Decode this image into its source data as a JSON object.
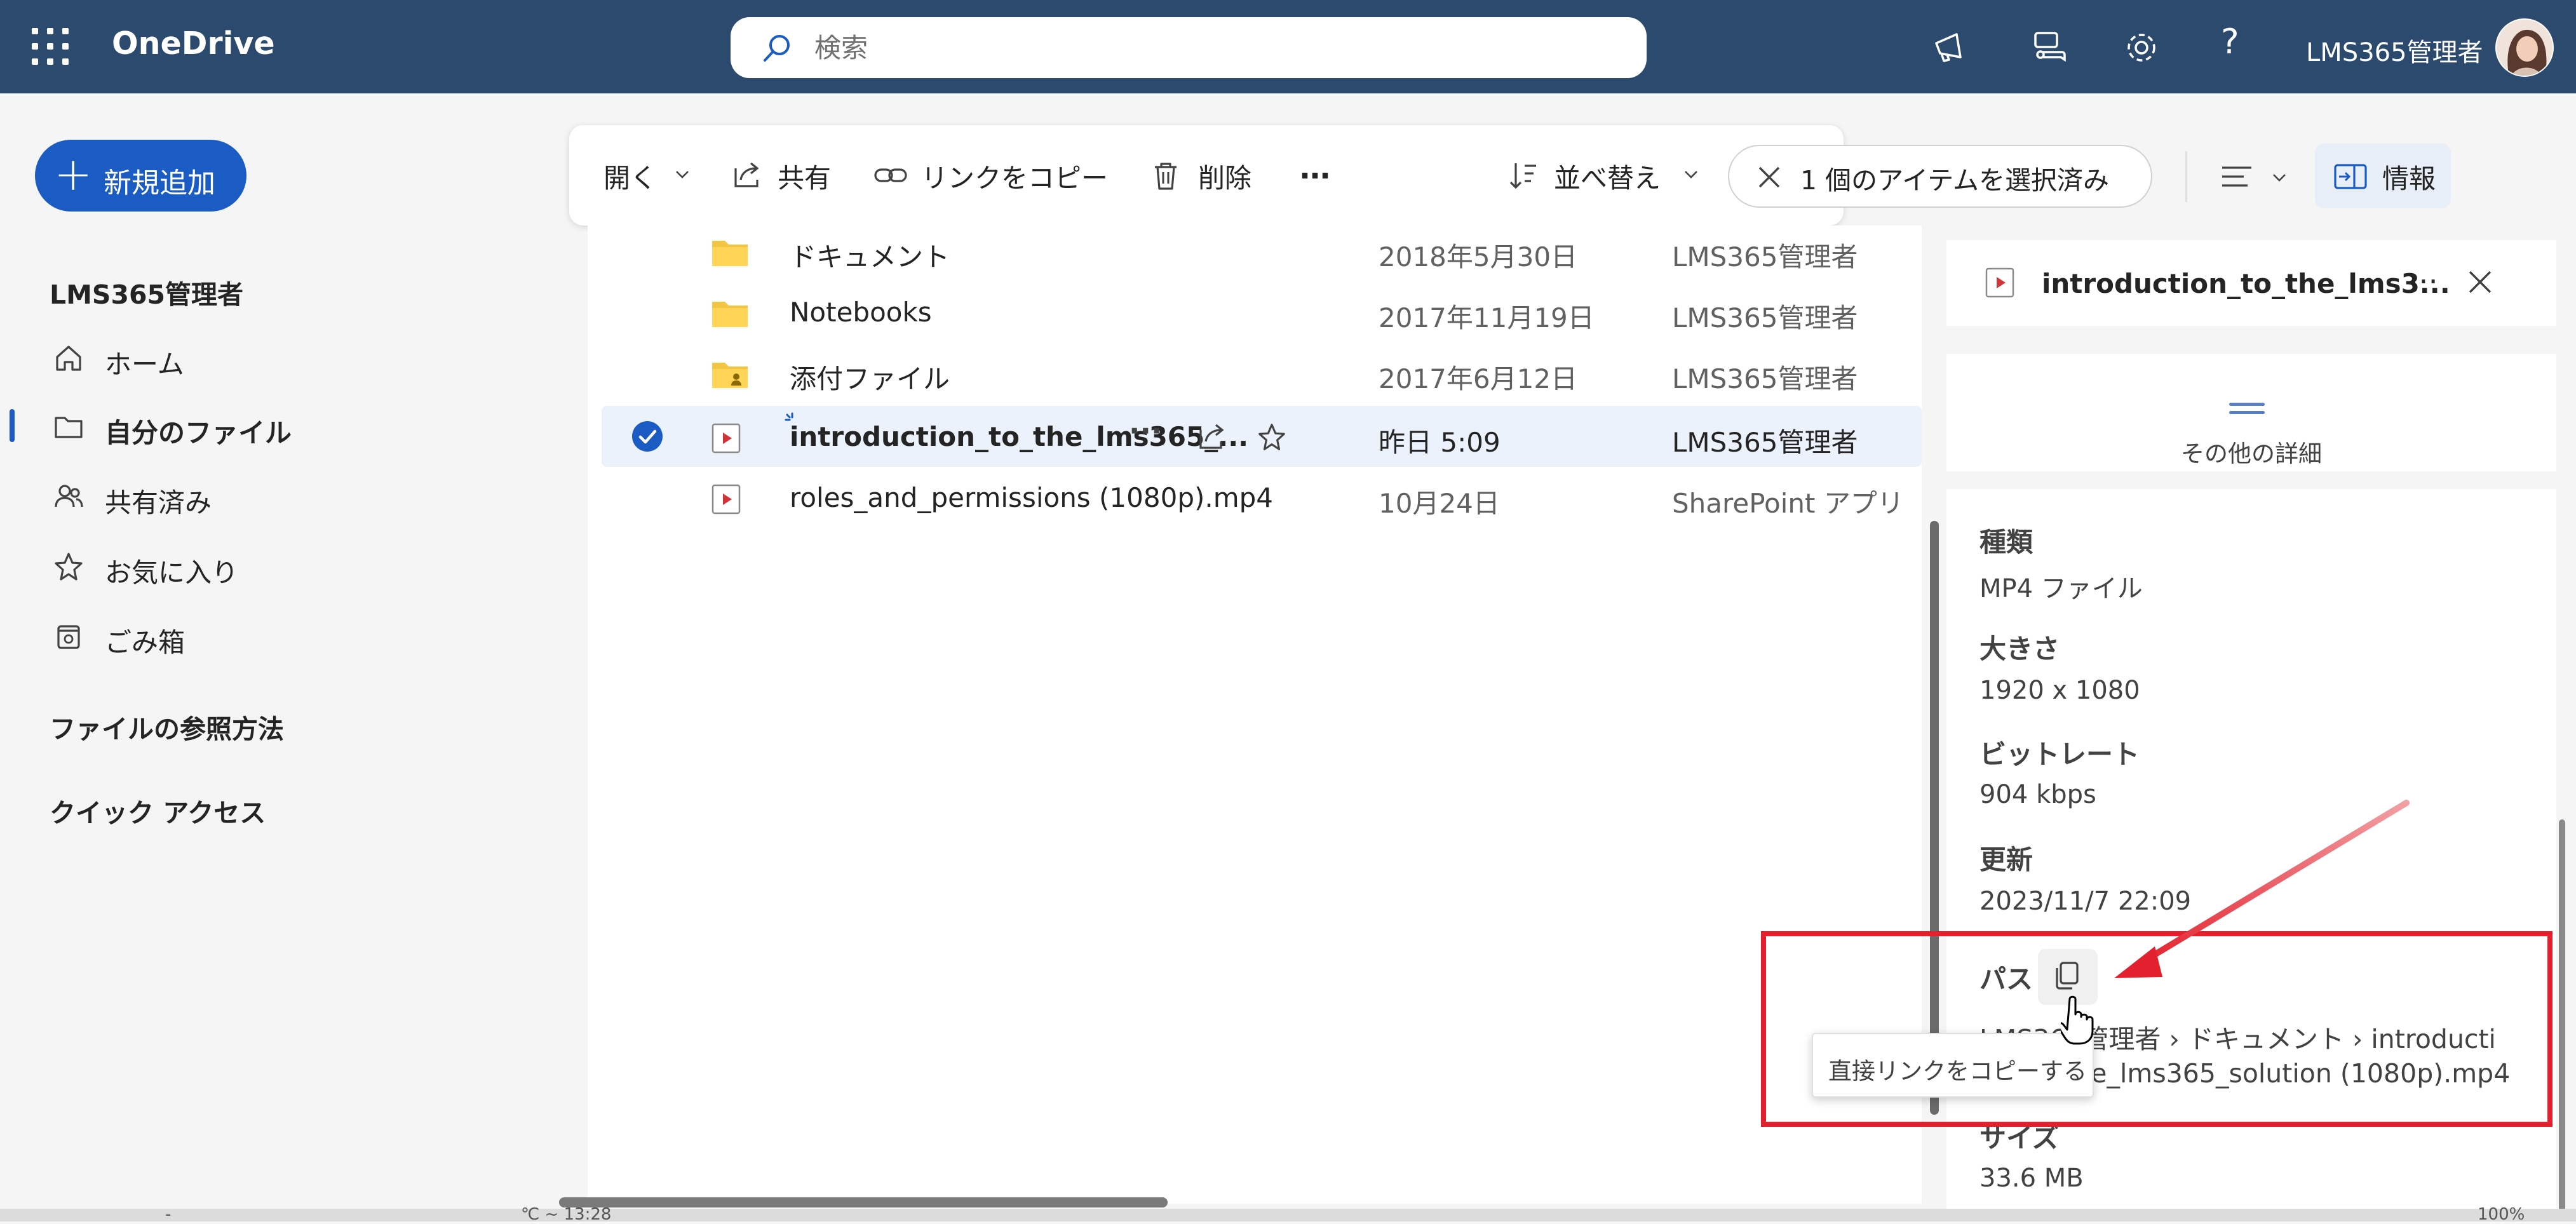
{
  "app": {
    "name": "OneDrive"
  },
  "search": {
    "placeholder": "検索"
  },
  "user": {
    "name": "LMS365管理者"
  },
  "new_button": {
    "label": "新規追加"
  },
  "sidebar": {
    "section_title": "LMS365管理者",
    "items": [
      {
        "label": "ホーム",
        "icon": "home-icon"
      },
      {
        "label": "自分のファイル",
        "icon": "folder-icon",
        "active": true
      },
      {
        "label": "共有済み",
        "icon": "people-icon"
      },
      {
        "label": "お気に入り",
        "icon": "star-icon"
      },
      {
        "label": "ごみ箱",
        "icon": "recycle-bin-icon"
      }
    ],
    "browse_heading": "ファイルの参照方法",
    "quick_access_heading": "クイック アクセス"
  },
  "commands": {
    "open": "開く",
    "share": "共有",
    "copy_link": "リンクをコピー",
    "delete": "削除",
    "more": "…",
    "sort": "並べ替え",
    "selection": "1 個のアイテムを選択済み",
    "info": "情報"
  },
  "files": [
    {
      "name": "ドキュメント",
      "modified": "2018年5月30日",
      "owner": "LMS365管理者",
      "type": "folder"
    },
    {
      "name": "Notebooks",
      "modified": "2017年11月19日",
      "owner": "LMS365管理者",
      "type": "folder"
    },
    {
      "name": "添付ファイル",
      "modified": "2017年6月12日",
      "owner": "LMS365管理者",
      "type": "shared-folder"
    },
    {
      "name": "introduction_to_the_lms365_...",
      "modified": "昨日 5:09",
      "owner": "LMS365管理者",
      "type": "video",
      "selected": true
    },
    {
      "name": "roles_and_permissions (1080p).mp4",
      "modified": "10月24日",
      "owner": "SharePoint アプリ",
      "type": "video"
    }
  ],
  "details": {
    "title": "introduction_to_the_lms3...",
    "more_details": "その他の詳細",
    "properties": [
      {
        "label": "種類",
        "value": "MP4 ファイル"
      },
      {
        "label": "大きさ",
        "value": "1920 x 1080"
      },
      {
        "label": "ビットレート",
        "value": "904 kbps"
      },
      {
        "label": "更新",
        "value": "2023/11/7 22:09"
      }
    ],
    "path": {
      "label": "パス",
      "line1": "LMS365管理者 › ドキュメント › introducti",
      "line2": "on_to_the_lms365_solution (1080p).mp4"
    },
    "size": {
      "label": "サイズ",
      "value": "33.6 MB"
    },
    "tooltip": "直接リンクをコピーする"
  },
  "bottom": {
    "left_text": "-",
    "mid_text": "℃ ~ 13:28",
    "right_text": "100%"
  },
  "colors": {
    "topbar": "#2c4a6e",
    "accent": "#1a5bc4",
    "highlight": "#e3202d",
    "selected_row": "#ebf2fb"
  }
}
